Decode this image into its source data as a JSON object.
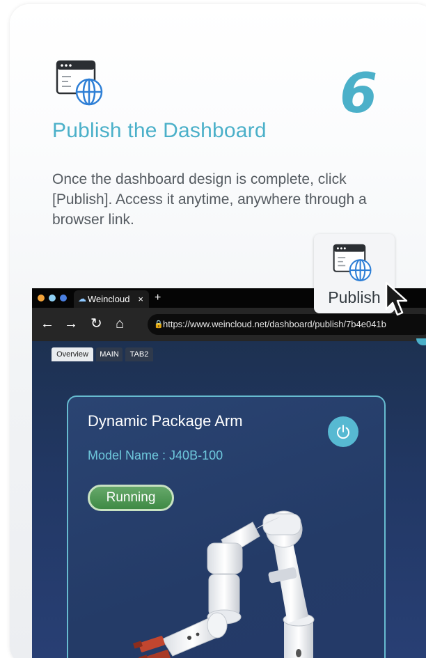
{
  "step": {
    "number": "6",
    "title": "Publish the Dashboard",
    "description": "Once the dashboard design is complete, click [Publish]. Access it anytime, anywhere through a browser link.",
    "icon": "browser-globe-icon"
  },
  "browser": {
    "tab_title": "Weincloud",
    "tab_close": "×",
    "new_tab": "+",
    "nav": {
      "back": "←",
      "forward": "→",
      "reload": "↻",
      "home": "⌂"
    },
    "url": "https://www.weincloud.net/dashboard/publish/7b4e041b",
    "window_dots": [
      "#f2a33a",
      "#8fd0f4",
      "#4a7fe0"
    ]
  },
  "dashboard": {
    "tabs": [
      "Overview",
      "MAIN",
      "TAB2"
    ],
    "device_name": "Dynamic Package Arm",
    "model_name": "Model Name : J40B-100",
    "status": "Running",
    "status_color": "#4a9a50",
    "accent_color": "#4bb0c9"
  },
  "publish_button": {
    "label": "Publish",
    "icon": "browser-globe-icon"
  }
}
